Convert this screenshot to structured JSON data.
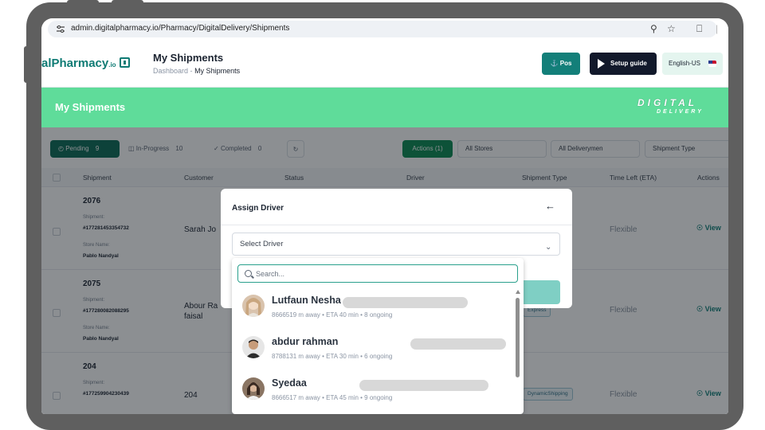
{
  "browser": {
    "url": "admin.digitalpharmacy.io/Pharmacy/DigitalDelivery/Shipments"
  },
  "header": {
    "logo_text": "alPharmacy",
    "logo_suffix": ".io",
    "title": "My Shipments",
    "breadcrumb_root": "Dashboard",
    "breadcrumb_sep": "-",
    "breadcrumb_current": "My Shipments",
    "pos_label": "Pos",
    "setup_label": "Setup guide",
    "language_label": "English-US"
  },
  "banner": {
    "title": "My Shipments",
    "brand_top": "DIGITAL",
    "brand_bottom": "DELIVERY"
  },
  "tabs": [
    {
      "label": "Pending",
      "count": "9"
    },
    {
      "label": "In-Progress",
      "count": "10"
    },
    {
      "label": "Completed",
      "count": "0"
    }
  ],
  "filters": {
    "actions_label": "Actions (1)",
    "stores": "All Stores",
    "deliverymen": "All Deliverymen",
    "shipment_type": "Shipment Type"
  },
  "table": {
    "columns": [
      "Shipment",
      "Customer",
      "Status",
      "Driver",
      "Shipment Type",
      "Time Left (ETA)",
      "Actions"
    ],
    "rows": [
      {
        "id": "2076",
        "shipment_label": "Shipment:",
        "shipment_no": "#177281453354732",
        "store_label": "Store Name:",
        "store": "Pablo Nandyal",
        "customer": "Sarah Jo",
        "time_left": "Flexible",
        "view": "View"
      },
      {
        "id": "2075",
        "shipment_label": "Shipment:",
        "shipment_no": "#177280082088295",
        "store_label": "Store Name:",
        "store": "Pablo Nandyal",
        "customer": "Abour Ra faisal",
        "type": "Express",
        "time_left": "Flexible",
        "view": "View"
      },
      {
        "id": "204",
        "shipment_label": "Shipment:",
        "shipment_no": "#177259904230439",
        "store_label": "",
        "store": "",
        "customer": "204",
        "type": "DynamicShipping",
        "time_left": "Flexible",
        "view": "View"
      }
    ]
  },
  "modal": {
    "title": "Assign Driver",
    "select_placeholder": "Select Driver",
    "search_placeholder": "Search..."
  },
  "drivers": [
    {
      "name": "Lutfaun Nesha",
      "meta": "8666519 m away • ETA 40 min • 8 ongoing"
    },
    {
      "name": "abdur rahman",
      "meta": "8788131 m away • ETA 30 min • 6 ongoing"
    },
    {
      "name": "Syedaa",
      "meta": "8666517 m away • ETA 45 min • 9 ongoing"
    }
  ]
}
